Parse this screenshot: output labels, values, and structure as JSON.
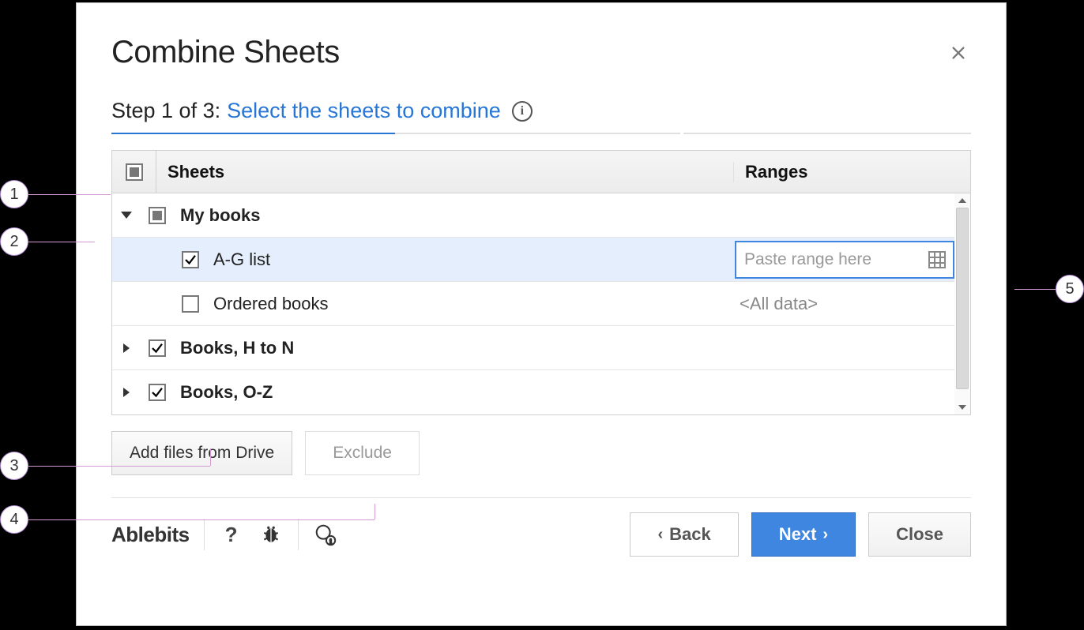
{
  "title": "Combine Sheets",
  "step_prefix": "Step 1 of 3: ",
  "step_link": "Select the sheets to combine",
  "columns": {
    "sheets": "Sheets",
    "ranges": "Ranges"
  },
  "tree": {
    "file1": {
      "name": "My books"
    },
    "file1_child1": {
      "name": "A-G list",
      "range_placeholder": "Paste range here"
    },
    "file1_child2": {
      "name": "Ordered books",
      "range_display": "<All data>"
    },
    "file2": {
      "name": "Books, H to N"
    },
    "file3": {
      "name": "Books, O-Z"
    }
  },
  "buttons": {
    "add_drive": "Add files from Drive",
    "exclude": "Exclude",
    "back": "Back",
    "next": "Next",
    "close": "Close"
  },
  "brand": "Ablebits",
  "callouts": {
    "c1": "1",
    "c2": "2",
    "c3": "3",
    "c4": "4",
    "c5": "5"
  }
}
